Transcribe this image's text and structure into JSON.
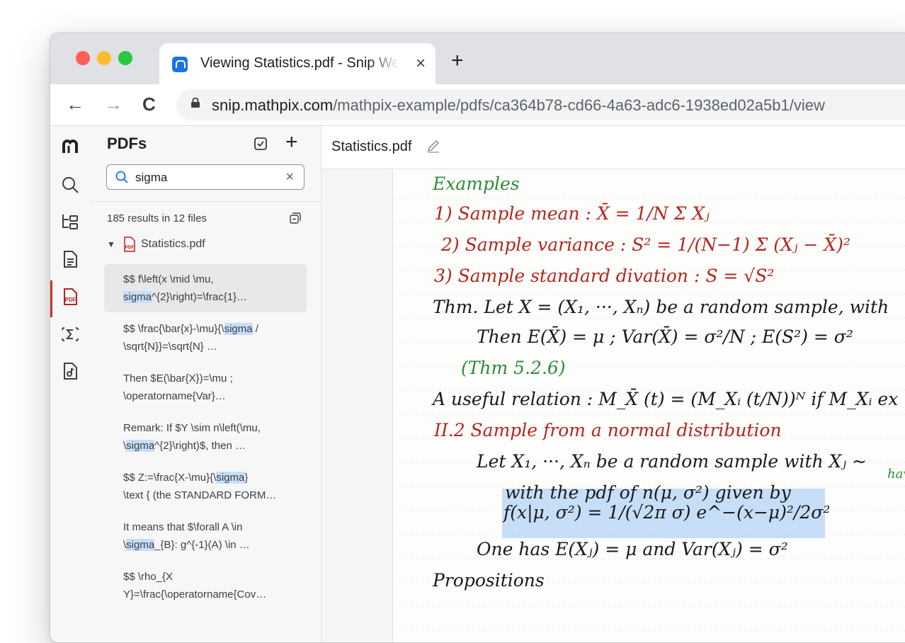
{
  "browser": {
    "tab_title": "Viewing Statistics.pdf - Snip Web",
    "tab_close": "×",
    "new_tab": "+",
    "back": "←",
    "forward": "→",
    "reload": "C",
    "url_host": "snip.mathpix.com",
    "url_path": "/mathpix-example/pdfs/ca364b78-cd66-4a63-adc6-1938ed02a5b1/view"
  },
  "rail": {
    "icons": [
      "mathpix-logo-icon",
      "search-icon",
      "tree-icon",
      "document-icon",
      "pdf-icon",
      "sigma-icon",
      "file-audio-icon"
    ],
    "active": "pdf-icon"
  },
  "sidebar": {
    "title": "PDFs",
    "add": "+",
    "search": {
      "value": "sigma",
      "clear": "×"
    },
    "results_count": "185 results in 12 files",
    "file": {
      "caret": "▼",
      "name": "Statistics.pdf"
    },
    "results": [
      {
        "pre1": "$$ f\\left(x \\mid \\mu,",
        "pre2": "",
        "hl": "sigma",
        "post2": "^{2}\\right)=\\frac{1}…",
        "selected": true,
        "hl_line": 2
      },
      {
        "pre1": "$$ \\frac{\\bar{x}-\\mu}{\\",
        "hl": "sigma",
        "post1": " /",
        "line2": "\\sqrt{N}}=\\sqrt{N} …",
        "hl_line": 1
      },
      {
        "line1": "Then $E(\\bar{X})=\\mu ;",
        "line2": "\\operatorname{Var}…",
        "hl_line": 0
      },
      {
        "line1": "Remark: If $Y \\sim n\\left(\\mu,",
        "pre2": "\\",
        "hl": "sigma",
        "post2": "^{2}\\right)$, then …",
        "hl_line": 2
      },
      {
        "pre1": "$$ Z:=\\frac{X-\\mu}{\\",
        "hl": "sigma",
        "post1": "}",
        "line2": "\\text { (the STANDARD FORM…",
        "hl_line": 1
      },
      {
        "line1": "It means that $\\forall A \\in",
        "pre2": "\\",
        "hl": "sigma",
        "post2": "_{B}: g^{-1}(A) \\in …",
        "hl_line": 2
      },
      {
        "line1": "$$ \\rho_{X",
        "line2": "Y}=\\frac{\\operatorname{Cov…",
        "hl_line": 0
      }
    ]
  },
  "document": {
    "title": "Statistics.pdf",
    "notes": [
      {
        "text": "Examples",
        "color": "green"
      },
      {
        "text": "1) Sample mean :  X̄ = 1/N Σ Xⱼ",
        "color": "red"
      },
      {
        "text": "2) Sample variance :  S² = 1/(N−1) Σ (Xⱼ − X̄)²",
        "color": "red"
      },
      {
        "text": "3) Sample standard divation :   S = √S²",
        "color": "red"
      },
      {
        "text": "Thm. Let X = (X₁, ···, Xₙ) be a random sample, with",
        "color": "black"
      },
      {
        "text": "Then  E(X̄) = μ ;  Var(X̄) = σ²/N ;  E(S²) = σ²",
        "color": "black"
      },
      {
        "text": "(Thm 5.2.6)",
        "color": "green"
      },
      {
        "text": "A useful relation :  M_X̄ (t) = (M_Xᵢ (t/N))ᴺ  if  M_Xᵢ ex",
        "color": "black"
      },
      {
        "text": "II.2 Sample from a normal distribution",
        "color": "red"
      },
      {
        "text": "Let X₁, ···, Xₙ be a random sample with  Xⱼ ~",
        "color": "black"
      },
      {
        "text": "with the pdf of  n(μ, σ²)  given by",
        "color": "black"
      },
      {
        "text": "f(x|μ, σ²) = 1/(√2π σ)  e^−(x−μ)²/2σ²",
        "color": "black"
      },
      {
        "text": "One has  E(Xⱼ) = μ and  Var(Xⱼ) = σ²",
        "color": "black"
      },
      {
        "text": "Propositions",
        "color": "black"
      }
    ],
    "side_note": "hav"
  }
}
